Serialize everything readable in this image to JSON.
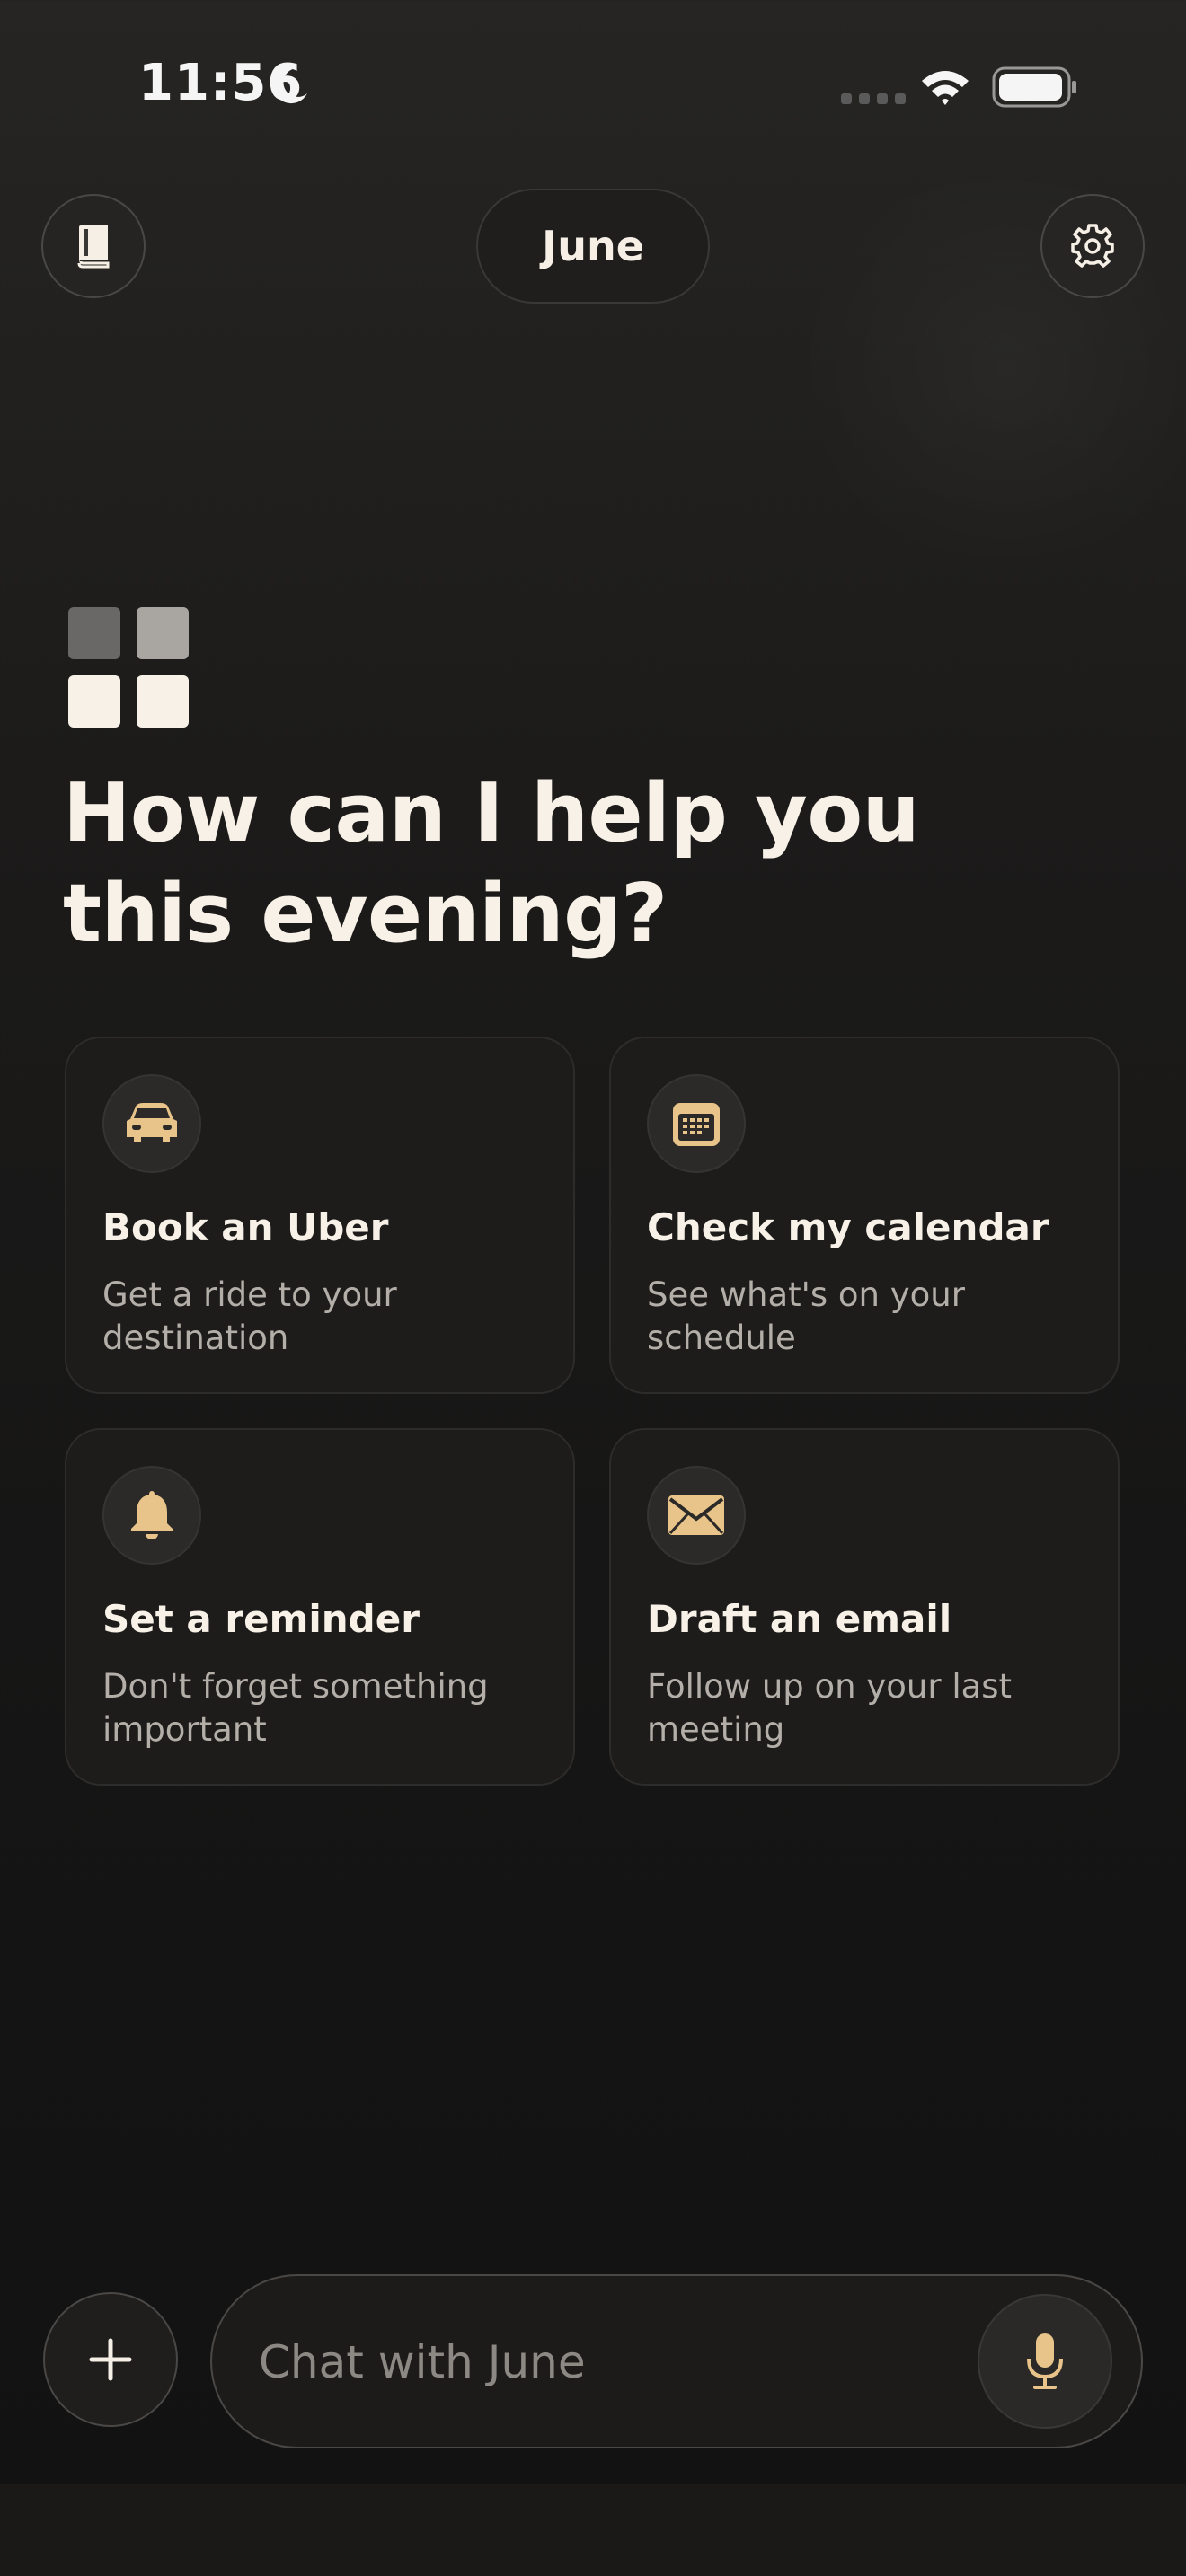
{
  "status_bar": {
    "time": "11:56",
    "icons": [
      "moon-icon",
      "cellular-signal-icon",
      "wifi-icon",
      "battery-icon"
    ]
  },
  "header": {
    "title": "June",
    "left_button_icon": "book-icon",
    "right_button_icon": "gear-icon"
  },
  "main": {
    "headline": "How can I help you this evening?",
    "logo_icon": "june-logo-grid-icon",
    "cards": [
      {
        "icon": "car-icon",
        "title": "Book an Uber",
        "description": "Get a ride to your destination"
      },
      {
        "icon": "calendar-icon",
        "title": "Check my calendar",
        "description": "See what's on your schedule"
      },
      {
        "icon": "bell-icon",
        "title": "Set a reminder",
        "description": "Don't forget something important"
      },
      {
        "icon": "envelope-icon",
        "title": "Draft an email",
        "description": "Follow up on your last meeting"
      }
    ]
  },
  "composer": {
    "placeholder": "Chat with June",
    "value": "",
    "add_icon": "plus-icon",
    "mic_icon": "microphone-icon"
  },
  "colors": {
    "background": "#1a1918",
    "accent": "#e8c48a",
    "text_primary": "#f7f1e7",
    "text_secondary": "#b3aea8"
  }
}
